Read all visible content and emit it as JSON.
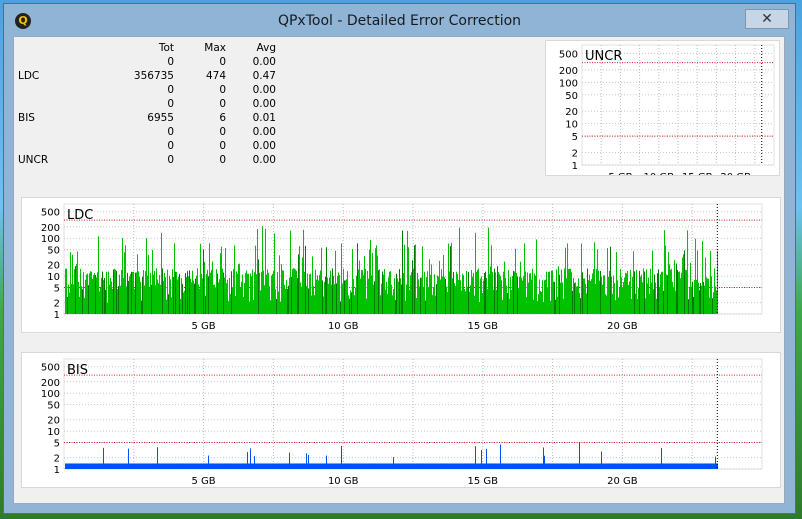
{
  "window": {
    "title": "QPxTool - Detailed Error Correction",
    "app_icon_glyph": "Q",
    "close_glyph": "✕"
  },
  "stats": {
    "headers": [
      "",
      "Tot",
      "Max",
      "Avg"
    ],
    "rows": [
      [
        "",
        "0",
        "0",
        "0.00"
      ],
      [
        "LDC",
        "356735",
        "474",
        "0.47"
      ],
      [
        "",
        "0",
        "0",
        "0.00"
      ],
      [
        "",
        "0",
        "0",
        "0.00"
      ],
      [
        "BIS",
        "6955",
        "6",
        "0.01"
      ],
      [
        "",
        "0",
        "0",
        "0.00"
      ],
      [
        "",
        "0",
        "0",
        "0.00"
      ],
      [
        "UNCR",
        "0",
        "0",
        "0.00"
      ]
    ]
  },
  "chart_data": [
    {
      "type": "bar",
      "title": "UNCR",
      "scale": "log",
      "ytick_labels": [
        "500",
        "200",
        "100",
        "50",
        "20",
        "10",
        "5",
        "2",
        "1"
      ],
      "xtick_labels": [
        "5 GB",
        "10 GB",
        "15 GB",
        "20 GB"
      ],
      "xlim": [
        0,
        25
      ],
      "data_end": 23.4,
      "values": [],
      "threshold_lines": [
        300,
        5
      ],
      "color": "#c00000"
    },
    {
      "type": "bar",
      "title": "LDC",
      "scale": "log",
      "ytick_labels": [
        "500",
        "200",
        "100",
        "50",
        "20",
        "10",
        "5",
        "2",
        "1"
      ],
      "xtick_labels": [
        "5 GB",
        "10 GB",
        "15 GB",
        "20 GB"
      ],
      "xlim": [
        0,
        25
      ],
      "data_end": 23.4,
      "max": 474,
      "typical_range": [
        3,
        20
      ],
      "threshold_lines": [
        300,
        5
      ],
      "color": "#00c000",
      "dark_color": "#007a00"
    },
    {
      "type": "bar",
      "title": "BIS",
      "scale": "log",
      "ytick_labels": [
        "500",
        "200",
        "100",
        "50",
        "20",
        "10",
        "5",
        "2",
        "1"
      ],
      "xtick_labels": [
        "5 GB",
        "10 GB",
        "15 GB",
        "20 GB"
      ],
      "xlim": [
        0,
        25
      ],
      "data_end": 23.4,
      "max": 6,
      "typical_range": [
        1,
        1
      ],
      "threshold_lines": [
        300,
        5
      ],
      "color": "#0050ff"
    }
  ]
}
